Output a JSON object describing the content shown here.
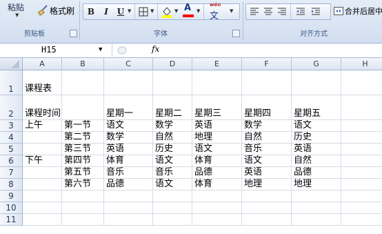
{
  "ribbon": {
    "paste_label": "粘贴",
    "format_painter_label": "格式刷",
    "clipboard_group": "剪贴板",
    "font_group": "字体",
    "align_group": "对齐方式",
    "bold": "B",
    "italic": "I",
    "underline": "U",
    "font_color_letter": "A",
    "phonetic_glyph": "文",
    "merge_center_label": "合并后居中",
    "fill_color": "#ffff00",
    "font_color": "#ff0000"
  },
  "formula_bar": {
    "name_box": "H15",
    "fx": "fx",
    "formula": ""
  },
  "columns": [
    "A",
    "B",
    "C",
    "D",
    "E",
    "F",
    "G",
    "H"
  ],
  "rows": [
    {
      "num": "1",
      "cells": [
        "课程表",
        "",
        "",
        "",
        "",
        "",
        "",
        ""
      ]
    },
    {
      "num": "2",
      "cells": [
        "课程时间",
        "",
        "星期一",
        "星期二",
        "星期三",
        "星期四",
        "星期五",
        ""
      ]
    },
    {
      "num": "3",
      "cells": [
        "上午",
        "第一节",
        "语文",
        "数学",
        "英语",
        "数学",
        "语文",
        ""
      ]
    },
    {
      "num": "4",
      "cells": [
        "",
        "第二节",
        "数学",
        "自然",
        "地理",
        "自然",
        "历史",
        ""
      ]
    },
    {
      "num": "5",
      "cells": [
        "",
        "第三节",
        "英语",
        "历史",
        "语文",
        "音乐",
        "英语",
        ""
      ]
    },
    {
      "num": "6",
      "cells": [
        "下午",
        "第四节",
        "体育",
        "语文",
        "体育",
        "语文",
        "自然",
        ""
      ]
    },
    {
      "num": "7",
      "cells": [
        "",
        "第五节",
        "音乐",
        "音乐",
        "品德",
        "英语",
        "品德",
        ""
      ]
    },
    {
      "num": "8",
      "cells": [
        "",
        "第六节",
        "品德",
        "语文",
        "体育",
        "地理",
        "地理",
        ""
      ]
    },
    {
      "num": "9",
      "cells": [
        "",
        "",
        "",
        "",
        "",
        "",
        "",
        ""
      ]
    },
    {
      "num": "10",
      "cells": [
        "",
        "",
        "",
        "",
        "",
        "",
        "",
        ""
      ]
    },
    {
      "num": "11",
      "cells": [
        "",
        "",
        "",
        "",
        "",
        "",
        "",
        ""
      ]
    }
  ]
}
